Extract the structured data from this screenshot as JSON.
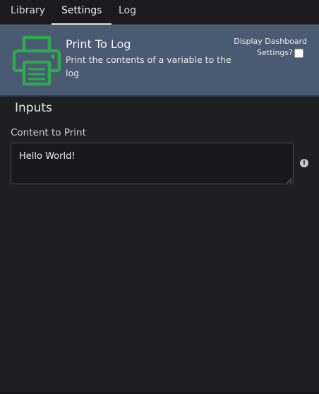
{
  "tabs": [
    {
      "label": "Library",
      "active": false
    },
    {
      "label": "Settings",
      "active": true
    },
    {
      "label": "Log",
      "active": false
    }
  ],
  "node": {
    "title": "Print To Log",
    "description": "Print the contents of a variable to the log",
    "icon": "printer-icon",
    "icon_color": "#2fa84f",
    "header_color": "#4a5a72"
  },
  "dashboard": {
    "label_line1": "Display Dashboard",
    "label_line2": "Settings?",
    "checked": false
  },
  "inputs": {
    "section_title": "Inputs",
    "content_label": "Content to Print",
    "content_value": "Hello World!",
    "info_icon": "info-icon"
  }
}
